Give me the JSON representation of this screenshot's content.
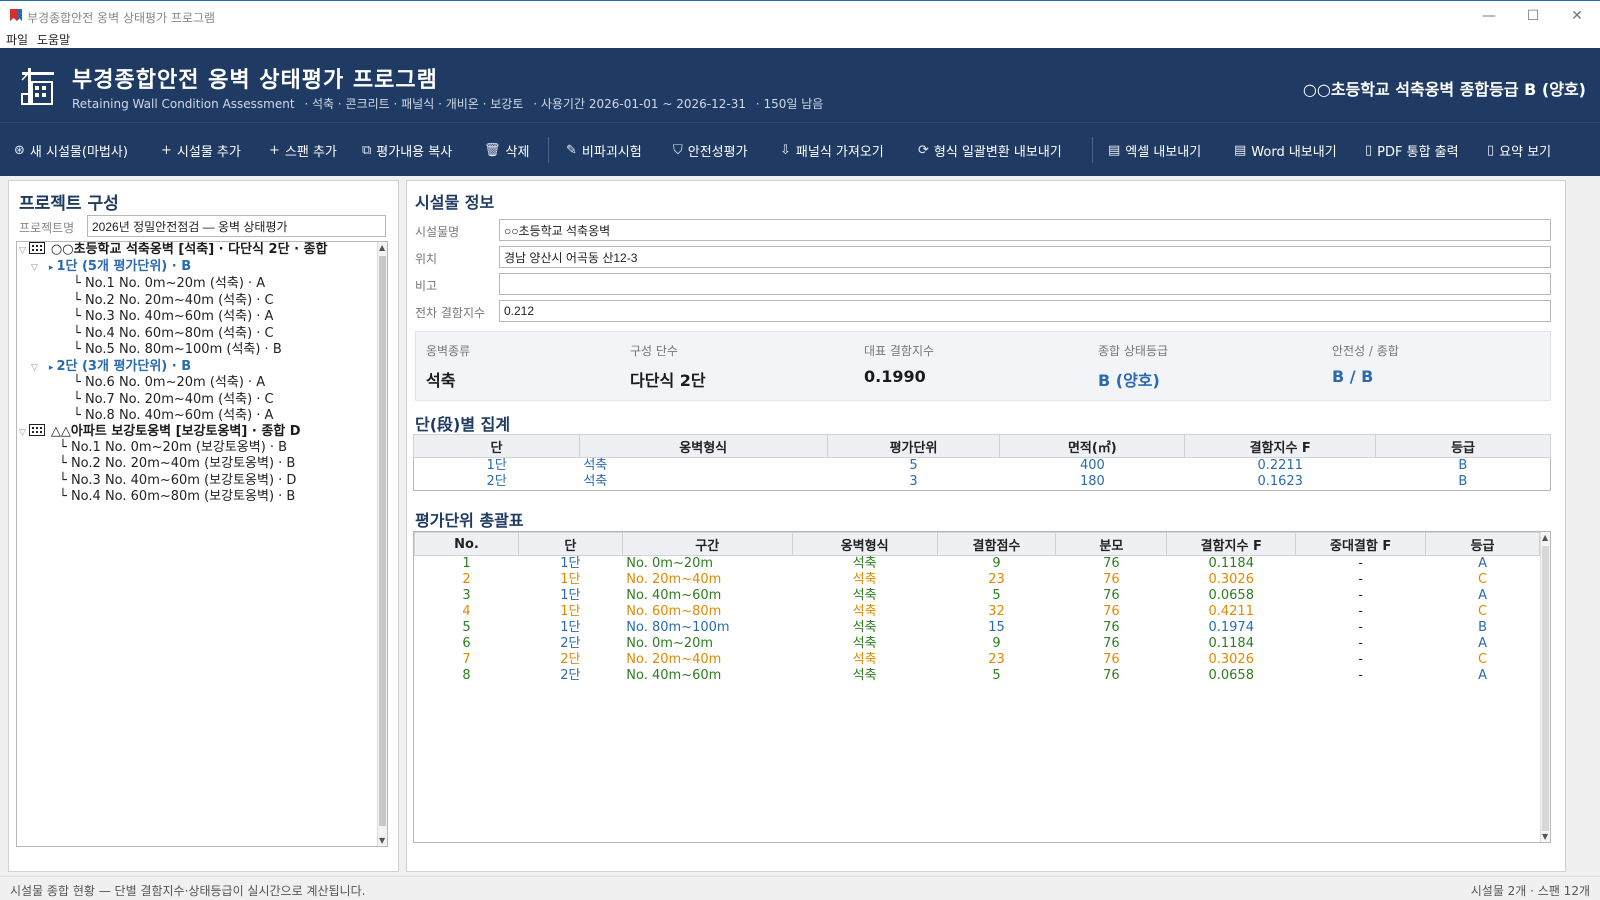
{
  "window": {
    "title": "부경종합안전 옹벽 상태평가 프로그램",
    "controls": {
      "minimize": "—",
      "maximize": "☐",
      "close": "✕"
    }
  },
  "menu": [
    "파일",
    "도움말"
  ],
  "header": {
    "title": "부경종합안전  옹벽 상태평가 프로그램",
    "subtitle": "Retaining Wall Condition Assessment",
    "types": "·  석축 · 콘크리트 · 패널식 · 개비온 · 보강토",
    "period": "·  사용기간 2026-01-01 ~ 2026-12-31",
    "remaining": "·  150일 남음",
    "grade_summary": "○○초등학교 석축옹벽 종합등급   B (양호)"
  },
  "toolbar": [
    {
      "icon": "⊛",
      "label": "새 시설물(마법사)"
    },
    {
      "icon": "+",
      "label": "시설물 추가"
    },
    {
      "icon": "+",
      "label": "스팬 추가"
    },
    {
      "icon": "⧉",
      "label": "평가내용 복사"
    },
    {
      "icon": "🗑",
      "label": "삭제"
    },
    {
      "icon": "✎",
      "label": "비파괴시험"
    },
    {
      "icon": "⛉",
      "label": "안전성평가"
    },
    {
      "icon": "⇩",
      "label": "패널식 가져오기"
    },
    {
      "icon": "⟳",
      "label": "형식 일괄변환 내보내기"
    },
    {
      "icon": "▤",
      "label": "엑셀 내보내기"
    },
    {
      "icon": "▤",
      "label": "Word 내보내기"
    },
    {
      "icon": "▯",
      "label": "PDF 통합 출력"
    },
    {
      "icon": "▯",
      "label": "요약 보기"
    }
  ],
  "project": {
    "panel_title": "프로젝트 구성",
    "name_label": "프로젝트명",
    "name_value": "2026년 정밀안전점검 — 옹벽 상태평가",
    "tree": [
      {
        "kind": "fac",
        "text": "○○초등학교 석축옹벽  [석축]  · 다단식 2단  · 종합"
      },
      {
        "kind": "tier",
        "text": "1단  (5개 평가단위)  · B"
      },
      {
        "kind": "unit",
        "text": "└ No.1 No. 0m~20m  (석축)  · A"
      },
      {
        "kind": "unit",
        "text": "└ No.2 No. 20m~40m  (석축)  · C"
      },
      {
        "kind": "unit",
        "text": "└ No.3 No. 40m~60m  (석축)  · A"
      },
      {
        "kind": "unit",
        "text": "└ No.4 No. 60m~80m  (석축)  · C"
      },
      {
        "kind": "unit",
        "text": "└ No.5 No. 80m~100m  (석축)  · B"
      },
      {
        "kind": "tier",
        "text": "2단  (3개 평가단위)  · B"
      },
      {
        "kind": "unit",
        "text": "└ No.6 No. 0m~20m  (석축)  · A"
      },
      {
        "kind": "unit",
        "text": "└ No.7 No. 20m~40m  (석축)  · C"
      },
      {
        "kind": "unit",
        "text": "└ No.8 No. 40m~60m  (석축)  · A"
      },
      {
        "kind": "fac",
        "text": "△△아파트 보강토옹벽  [보강토옹벽]  · 종합 D"
      },
      {
        "kind": "unit2",
        "text": "└ No.1 No. 0m~20m  (보강토옹벽)  · B"
      },
      {
        "kind": "unit2",
        "text": "└ No.2 No. 20m~40m  (보강토옹벽)  · B"
      },
      {
        "kind": "unit2",
        "text": "└ No.3 No. 40m~60m  (보강토옹벽)  · D"
      },
      {
        "kind": "unit2",
        "text": "└ No.4 No. 60m~80m  (보강토옹벽)  · B"
      }
    ]
  },
  "facility": {
    "section_title": "시설물 정보",
    "fields": [
      {
        "label": "시설물명",
        "value": "○○초등학교 석축옹벽"
      },
      {
        "label": "위치",
        "value": "경남 양산시 어곡동 산12-3"
      },
      {
        "label": "비고",
        "value": ""
      },
      {
        "label": "전차 결함지수",
        "value": "0.212"
      }
    ],
    "summary": [
      {
        "label": "옹벽종류",
        "value": "석축",
        "blue": false
      },
      {
        "label": "구성 단수",
        "value": "다단식 2단",
        "blue": false
      },
      {
        "label": "대표 결함지수",
        "value": "0.1990",
        "blue": false
      },
      {
        "label": "종합 상태등급",
        "value": "B (양호)",
        "blue": true
      },
      {
        "label": "안전성 / 종합",
        "value": "B / B",
        "blue": true
      }
    ]
  },
  "tier_summary": {
    "title": "단(段)별 집계",
    "headers": [
      "단",
      "옹벽형식",
      "평가단위",
      "면적(㎡)",
      "결함지수 F",
      "등급"
    ],
    "rows": [
      [
        "1단",
        "석축",
        "5",
        "400",
        "0.2211",
        "B"
      ],
      [
        "2단",
        "석축",
        "3",
        "180",
        "0.1623",
        "B"
      ]
    ]
  },
  "unit_summary": {
    "title": "평가단위 총괄표",
    "headers": [
      "No.",
      "단",
      "구간",
      "옹벽형식",
      "결함점수",
      "분모",
      "결함지수 F",
      "중대결함 F",
      "등급"
    ],
    "rows": [
      [
        "1",
        "1단",
        "No. 0m~20m",
        "석축",
        "9",
        "76",
        "0.1184",
        "-",
        "A"
      ],
      [
        "2",
        "1단",
        "No. 20m~40m",
        "석축",
        "23",
        "76",
        "0.3026",
        "-",
        "C"
      ],
      [
        "3",
        "1단",
        "No. 40m~60m",
        "석축",
        "5",
        "76",
        "0.0658",
        "-",
        "A"
      ],
      [
        "4",
        "1단",
        "No. 60m~80m",
        "석축",
        "32",
        "76",
        "0.4211",
        "-",
        "C"
      ],
      [
        "5",
        "1단",
        "No. 80m~100m",
        "석축",
        "15",
        "76",
        "0.1974",
        "-",
        "B"
      ],
      [
        "6",
        "2단",
        "No. 0m~20m",
        "석축",
        "9",
        "76",
        "0.1184",
        "-",
        "A"
      ],
      [
        "7",
        "2단",
        "No. 20m~40m",
        "석축",
        "23",
        "76",
        "0.3026",
        "-",
        "C"
      ],
      [
        "8",
        "2단",
        "No. 40m~60m",
        "석축",
        "5",
        "76",
        "0.0658",
        "-",
        "A"
      ]
    ]
  },
  "status": {
    "left": "시설물 종합 현황 — 단별 결함지수·상태등급이 실시간으로 계산됩니다.",
    "right": "시설물 2개  ·  스팬 12개"
  },
  "colors": {
    "navy": "#1f3b63",
    "blue": "#2a6bb0",
    "green": "#2e7d1e",
    "orange": "#e08a00"
  }
}
